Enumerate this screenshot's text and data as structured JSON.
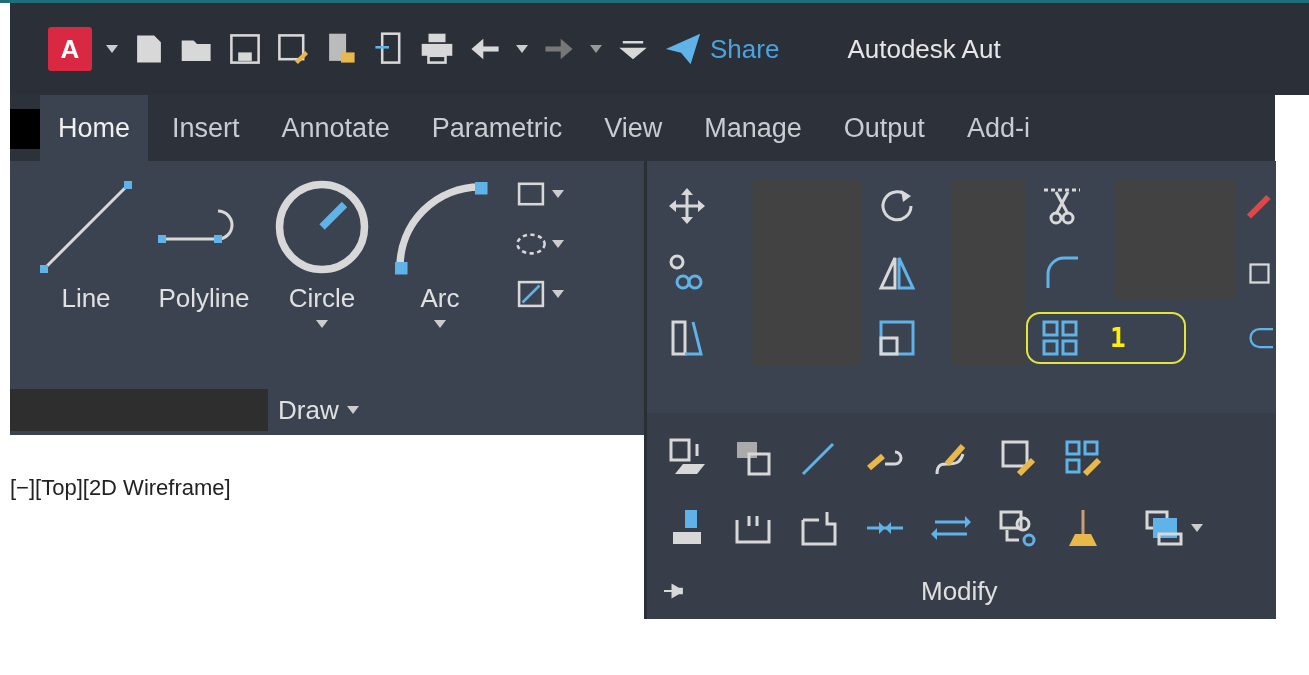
{
  "quick_access": {
    "app_letter": "A",
    "share": "Share",
    "title": "Autodesk Aut"
  },
  "tabs": [
    {
      "label": "Home",
      "selected": true
    },
    {
      "label": "Insert",
      "selected": false
    },
    {
      "label": "Annotate",
      "selected": false
    },
    {
      "label": "Parametric",
      "selected": false
    },
    {
      "label": "View",
      "selected": false
    },
    {
      "label": "Manage",
      "selected": false
    },
    {
      "label": "Output",
      "selected": false
    },
    {
      "label": "Add-i",
      "selected": false
    }
  ],
  "draw_panel": {
    "title": "Draw",
    "tools": [
      {
        "label": "Line",
        "dropdown": false
      },
      {
        "label": "Polyline",
        "dropdown": false
      },
      {
        "label": "Circle",
        "dropdown": true
      },
      {
        "label": "Arc",
        "dropdown": true
      }
    ]
  },
  "viewport": {
    "label": "[−][Top][2D Wireframe]"
  },
  "modify_panel": {
    "title": "Modify",
    "callout": "1"
  }
}
